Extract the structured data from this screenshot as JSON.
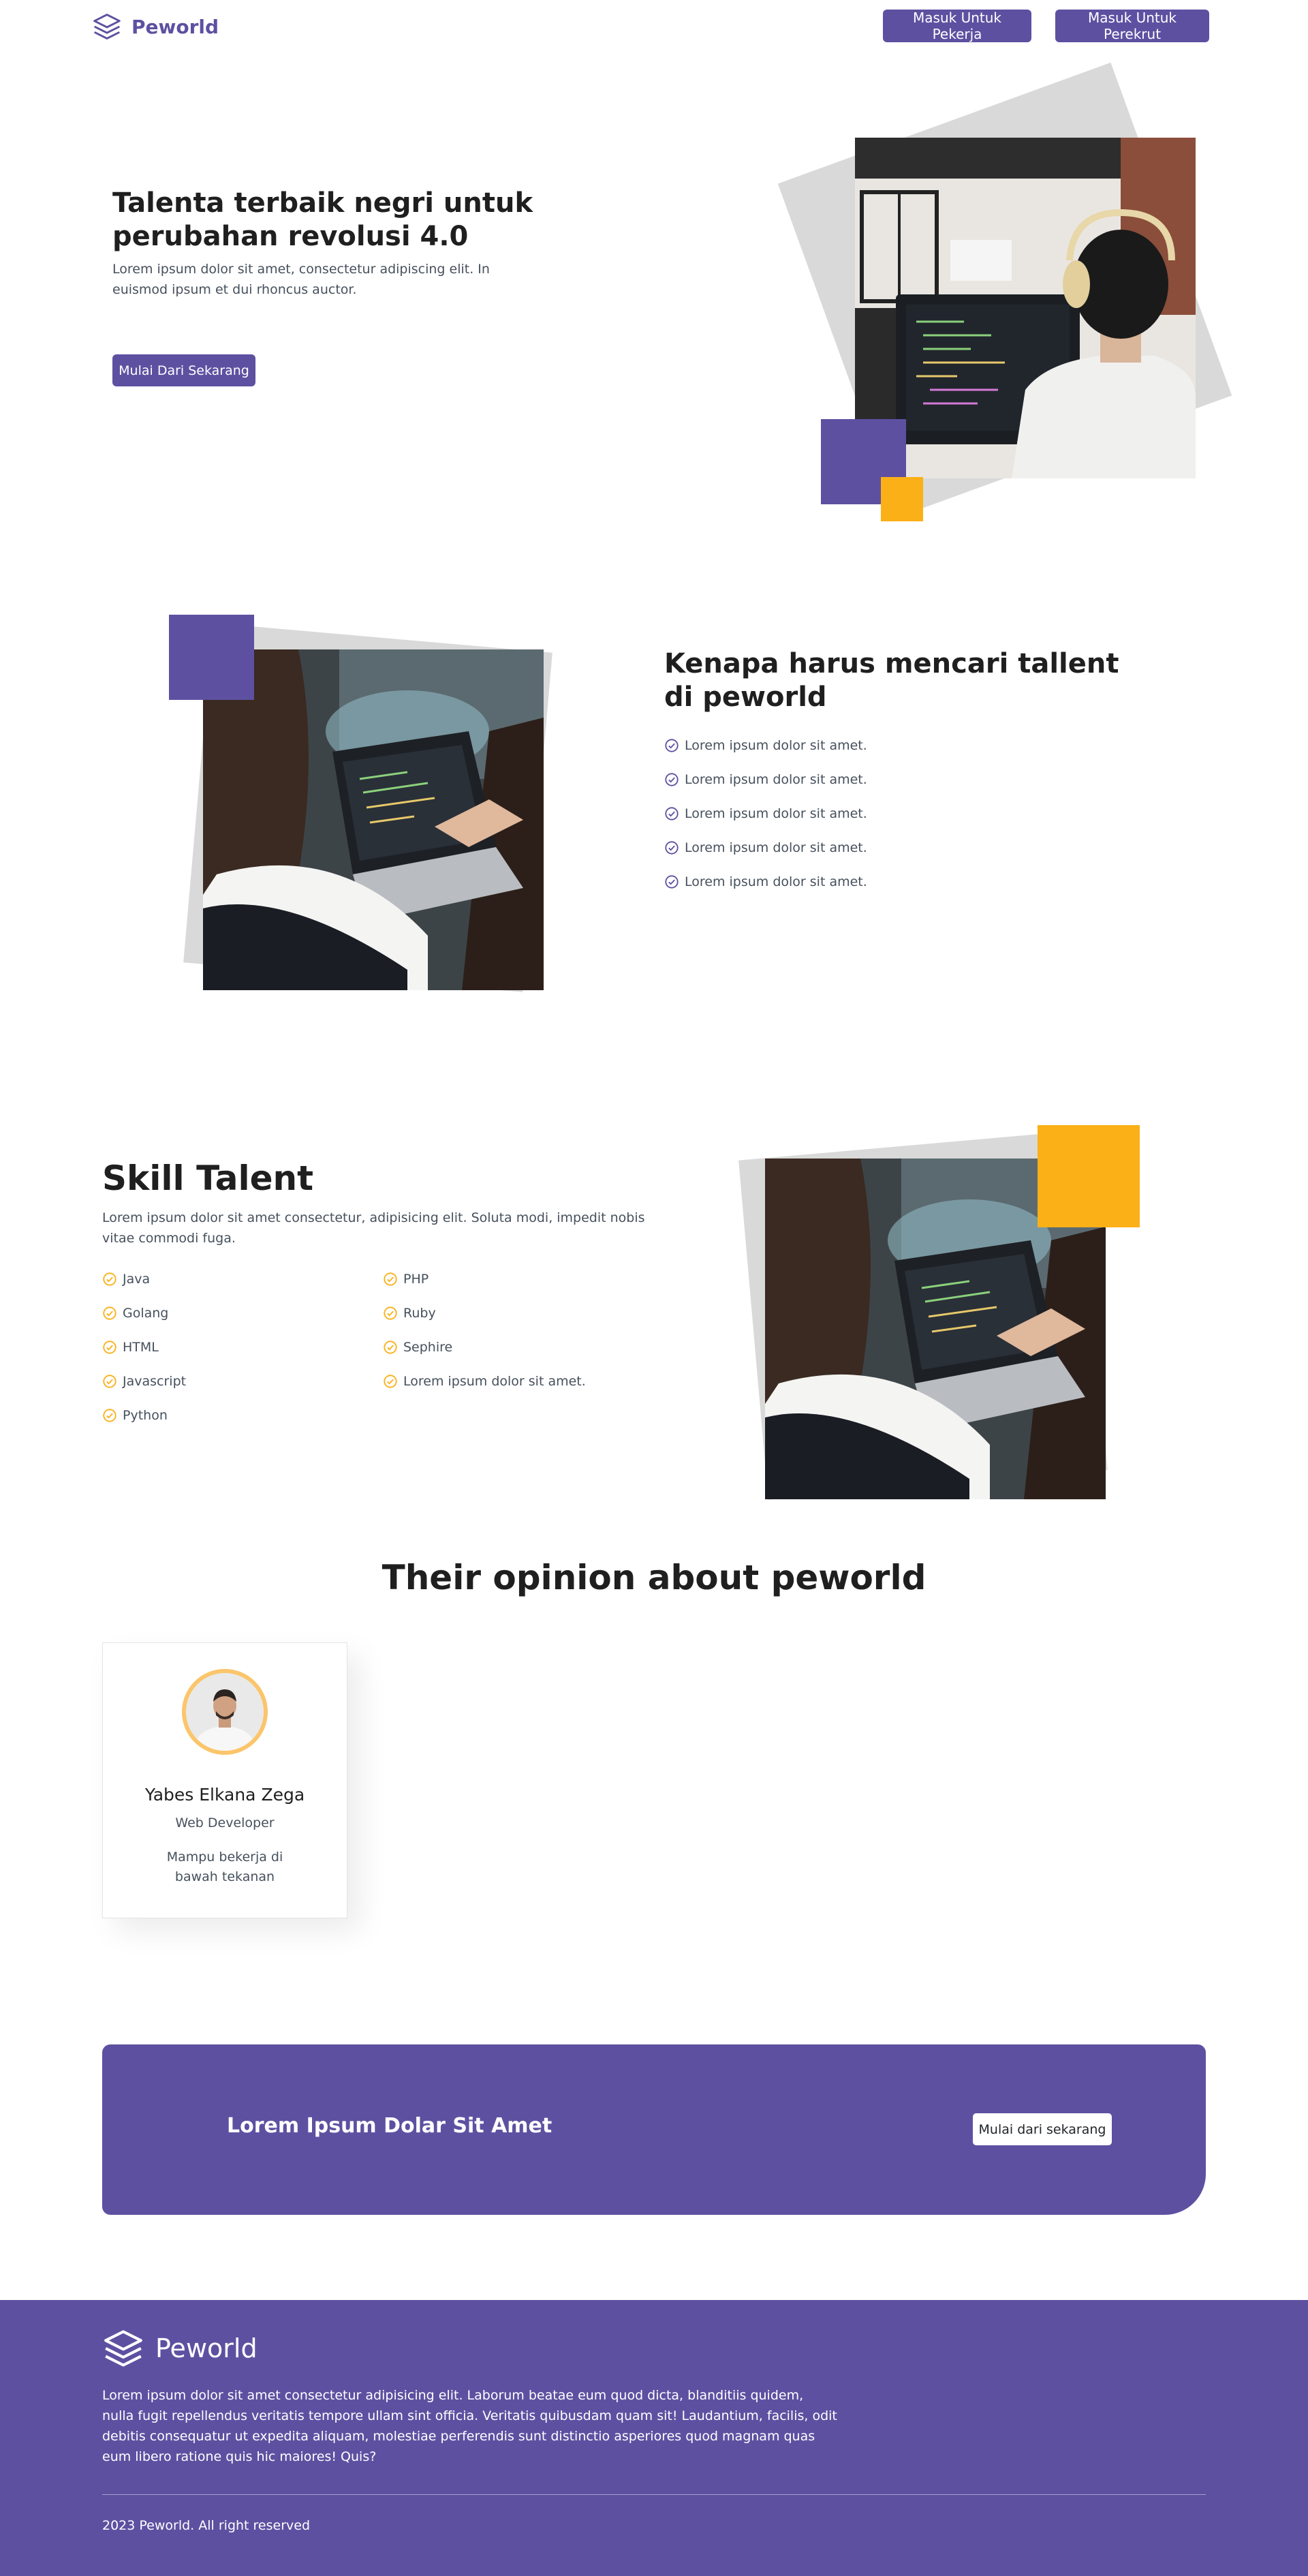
{
  "nav": {
    "brand": "Peworld",
    "login_worker": "Masuk Untuk Pekerja",
    "login_recruiter": "Masuk Untuk Perekrut"
  },
  "hero": {
    "title": "Talenta terbaik negri untuk perubahan revolusi 4.0",
    "description": "Lorem ipsum dolor sit amet, consectetur adipiscing elit. In euismod ipsum et dui rhoncus auctor.",
    "cta": "Mulai Dari Sekarang"
  },
  "why": {
    "title": "Kenapa harus mencari tallent di peworld",
    "items": [
      "Lorem ipsum dolor sit amet.",
      "Lorem ipsum dolor sit amet.",
      "Lorem ipsum dolor sit amet.",
      "Lorem ipsum dolor sit amet.",
      "Lorem ipsum dolor sit amet."
    ]
  },
  "skill": {
    "title": "Skill Talent",
    "description": "Lorem ipsum dolor sit amet consectetur, adipisicing elit. Soluta modi, impedit nobis vitae commodi fuga.",
    "col1": [
      "Java",
      "Golang",
      "HTML",
      "Javascript",
      "Python"
    ],
    "col2": [
      "PHP",
      "Ruby",
      "Sephire",
      "Lorem ipsum dolor sit amet."
    ]
  },
  "opinion": {
    "title": "Their opinion about peworld",
    "card": {
      "name": "Yabes Elkana Zega",
      "role": "Web Developer",
      "text": "Mampu bekerja di bawah tekanan"
    }
  },
  "cta": {
    "text": "Lorem Ipsum Dolar Sit Amet",
    "button": "Mulai dari sekarang"
  },
  "footer": {
    "brand": "Peworld",
    "description": "Lorem ipsum dolor sit amet consectetur adipisicing elit. Laborum beatae eum quod dicta, blanditiis quidem, nulla fugit repellendus veritatis tempore ullam sint officia. Veritatis quibusdam quam sit! Laudantium, facilis, odit debitis consequatur ut expedita aliquam, molestiae perferendis sunt distinctio asperiores quod magnam quas eum libero ratione quis hic maiores! Quis?",
    "copyright": "2023 Peworld. All right reserved"
  },
  "colors": {
    "primary": "#5e50a1",
    "accent": "#fbb017",
    "check_purple": "#5e50a1",
    "check_yellow": "#fbb017"
  },
  "icons": {
    "brand": "layers-icon",
    "check": "check-circle-icon"
  }
}
